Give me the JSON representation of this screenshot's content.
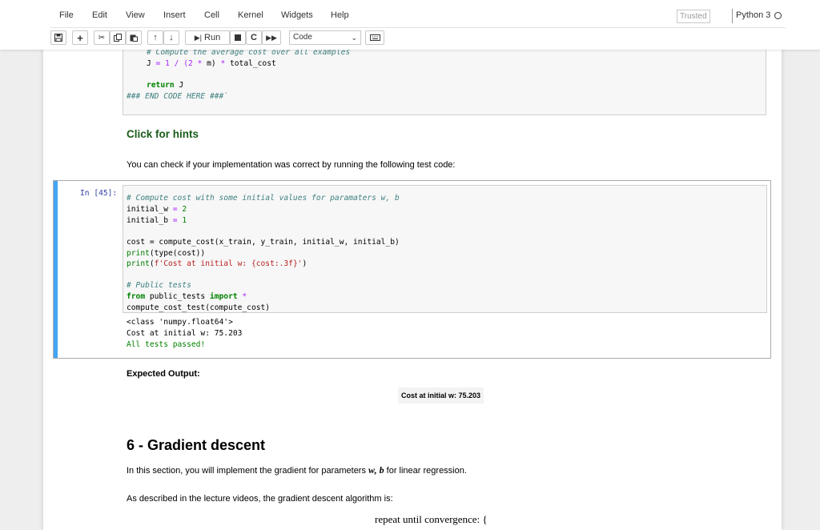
{
  "menu": [
    "File",
    "Edit",
    "View",
    "Insert",
    "Cell",
    "Kernel",
    "Widgets",
    "Help"
  ],
  "trusted_label": "Trusted",
  "kernel_name": "Python 3",
  "toolbar": {
    "run_label": "Run",
    "cell_type": "Code",
    "icons": [
      "save-icon",
      "plus-icon",
      "cut-icon",
      "copy-icon",
      "paste-icon",
      "arrow-up-icon",
      "arrow-down-icon",
      "run-icon",
      "stop-icon",
      "restart-icon",
      "fast-forward-icon",
      "keyboard-icon"
    ]
  },
  "prev_cell": {
    "comment": "# Compute the average cost over all examples",
    "assign_var": "J",
    "assign_expr_pre": " = 1 / (2 ",
    "assign_star": "*",
    "assign_expr_mid": " m) ",
    "assign_star2": "*",
    "assign_expr_post": " total_cost",
    "return_kw": "return",
    "return_val": " J",
    "end_marker": "### END CODE HERE ###`"
  },
  "hints_link": "Click for hints",
  "check_text": "You can check if your implementation was correct by running the following test code:",
  "cell45": {
    "prompt": "In [45]:",
    "lines": {
      "c1": "# Compute cost with some initial values for paramaters w, b",
      "l2_var": "initial_w",
      "l2_val": "2",
      "l3_var": "initial_b",
      "l3_val": "1",
      "l5": "cost = compute_cost(x_train, y_train, initial_w, initial_b)",
      "l6_fn": "print",
      "l6_inner": "(type(cost))",
      "l7_fn": "print",
      "l7_str": "f'Cost at initial w: {cost:.3f}'",
      "l7_close": ")",
      "c9": "# Public tests",
      "l10_from": "from",
      "l10_mod": " public_tests ",
      "l10_import": "import",
      "l10_star": " *",
      "l11": "compute_cost_test(compute_cost)"
    },
    "output": [
      "<class 'numpy.float64'>",
      "Cost at initial w: 75.203",
      "All tests passed!"
    ]
  },
  "expected_label": "Expected Output:",
  "expected_value": "Cost at initial w: 75.203",
  "section_heading": "6 - Gradient descent",
  "section_text_pre": "In this section, you will implement the gradient for parameters ",
  "section_math": "w, b",
  "section_text_post": " for linear regression.",
  "lecture_text": "As described in the lecture videos, the gradient descent algorithm is:",
  "repeat_text": "repeat until convergence: {"
}
